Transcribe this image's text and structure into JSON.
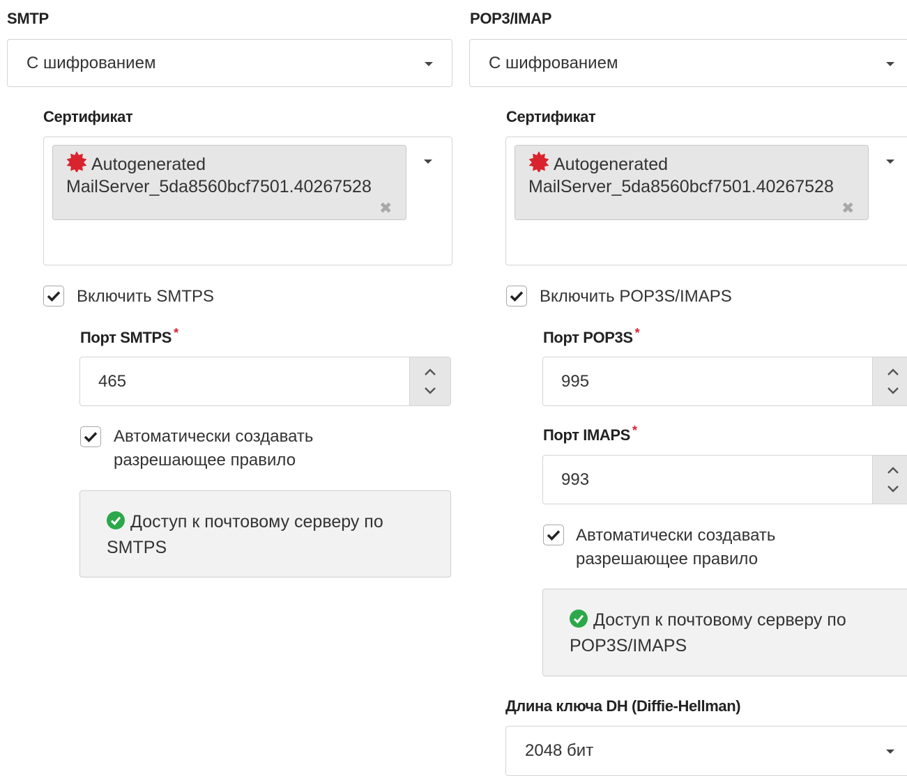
{
  "smtp": {
    "title": "SMTP",
    "encryption": "С шифрованием",
    "cert_label": "Сертификат",
    "cert_line1": "Autogenerated",
    "cert_line2": "MailServer_5da8560bcf7501.40267528",
    "enable_label": "Включить SMTPS",
    "port_label": "Порт SMTPS",
    "port_value": "465",
    "auto_rule_line1": "Автоматически создавать",
    "auto_rule_line2": "разрешающее правило",
    "access_line1": "Доступ к почтовому серверу по",
    "access_line2": "SMTPS"
  },
  "pop3imap": {
    "title": "POP3/IMAP",
    "encryption": "С шифрованием",
    "cert_label": "Сертификат",
    "cert_line1": "Autogenerated",
    "cert_line2": "MailServer_5da8560bcf7501.40267528",
    "enable_label": "Включить POP3S/IMAPS",
    "pop3s_label": "Порт POP3S",
    "pop3s_value": "995",
    "imaps_label": "Порт IMAPS",
    "imaps_value": "993",
    "auto_rule_line1": "Автоматически создавать",
    "auto_rule_line2": "разрешающее правило",
    "access_line1": "Доступ к почтовому серверу по",
    "access_line2": "POP3S/IMAPS",
    "dh_label": "Длина ключа DH (Diffie-Hellman)",
    "dh_value": "2048 бит"
  },
  "required_mark": "*",
  "remove_glyph": "✖",
  "colors": {
    "required": "#d9232e",
    "cert_icon": "#d9232e",
    "ok_icon": "#2ca84a"
  }
}
